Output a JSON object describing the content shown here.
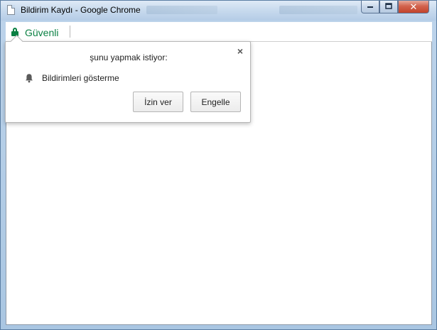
{
  "window": {
    "title": "Bildirim Kaydı - Google Chrome",
    "controls": {
      "minimize_icon": "minimize-icon",
      "maximize_icon": "maximize-icon",
      "close_icon": "close-icon",
      "close_glyph": "✕"
    }
  },
  "omnibox": {
    "security_label": "Güvenli",
    "security_icon": "lock-icon",
    "security_color": "#0b8043"
  },
  "permission_prompt": {
    "title": "şunu yapmak istiyor:",
    "close_glyph": "×",
    "permission_icon": "bell-icon",
    "permission_text": "Bildirimleri gösterme",
    "allow_label": "İzin ver",
    "block_label": "Engelle"
  }
}
